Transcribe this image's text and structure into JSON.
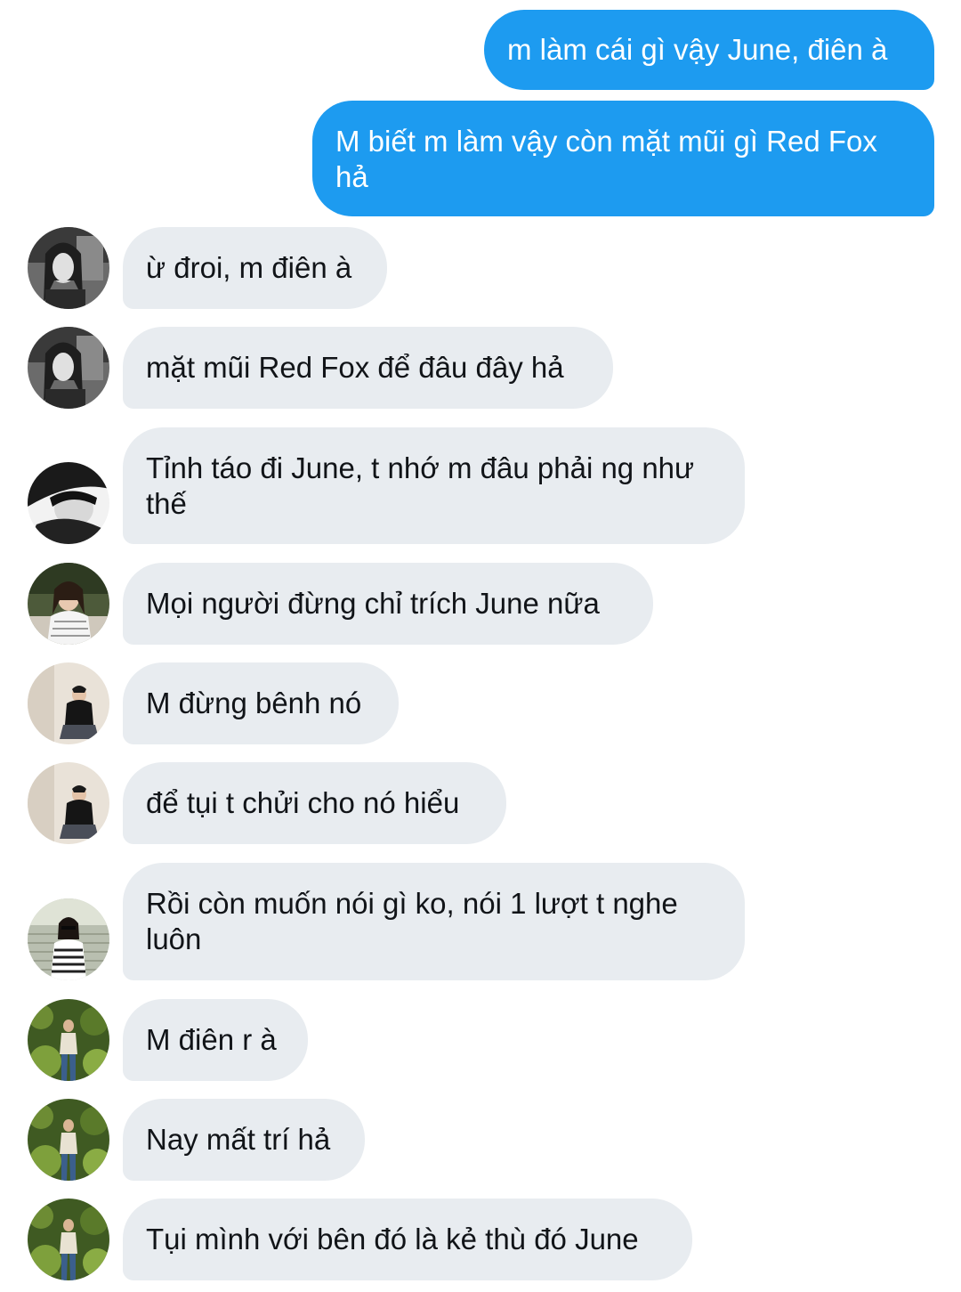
{
  "conversation": {
    "messages": [
      {
        "direction": "out",
        "text": "m làm cái gì vậy June, điên à"
      },
      {
        "direction": "out",
        "text": "M biết m làm vậy còn mặt mũi gì Red Fox hả"
      },
      {
        "direction": "in",
        "avatar": "avatar-girl-bw",
        "text": "ừ đroi, m điên à"
      },
      {
        "direction": "in",
        "avatar": "avatar-girl-bw",
        "text": "mặt mũi Red Fox để đâu đây hả"
      },
      {
        "direction": "in",
        "avatar": "avatar-boy-cap",
        "text": "Tỉnh táo đi June, t nhớ m đâu phải ng như thế"
      },
      {
        "direction": "in",
        "avatar": "avatar-girl-cafe",
        "text": "Mọi người đừng chỉ trích June nữa"
      },
      {
        "direction": "in",
        "avatar": "avatar-boy-sitting",
        "text": "M đừng bênh nó"
      },
      {
        "direction": "in",
        "avatar": "avatar-boy-sitting",
        "text": "để tụi t chửi cho nó hiểu"
      },
      {
        "direction": "in",
        "avatar": "avatar-girl-stairs",
        "text": "Rồi còn muốn nói gì ko, nói 1 lượt t nghe luôn"
      },
      {
        "direction": "in",
        "avatar": "avatar-boy-garden",
        "text": "M điên r à"
      },
      {
        "direction": "in",
        "avatar": "avatar-boy-garden",
        "text": "Nay mất trí hả"
      },
      {
        "direction": "in",
        "avatar": "avatar-boy-garden",
        "text": "Tụi mình với bên đó là kẻ thù đó June"
      }
    ]
  },
  "colors": {
    "outgoing_bubble": "#1d9bf0",
    "incoming_bubble": "#e8ecf0",
    "outgoing_text": "#ffffff",
    "incoming_text": "#111418"
  }
}
